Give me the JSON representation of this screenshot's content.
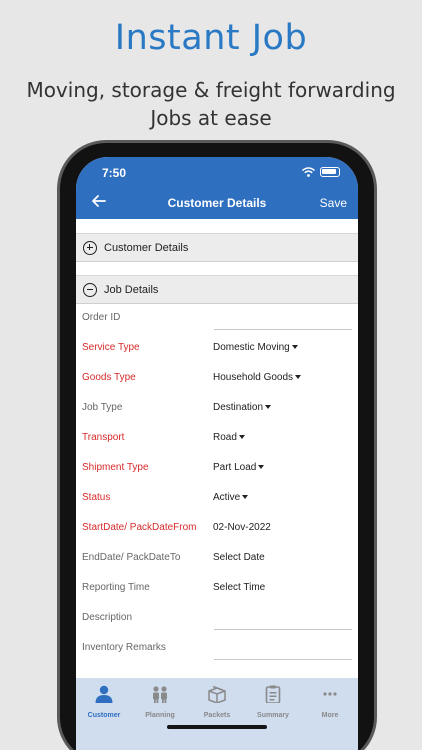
{
  "promo": {
    "title": "Instant Job",
    "subtitle_line1": "Moving, storage & freight forwarding",
    "subtitle_line2": "Jobs at ease"
  },
  "colors": {
    "brand_blue": "#2f6fc0",
    "title_blue": "#2a79c4",
    "required_red": "#d72a2a",
    "tabbar_bg": "#cfddef"
  },
  "status_bar": {
    "time": "7:50",
    "icons": [
      "wifi-icon",
      "battery-icon"
    ]
  },
  "nav": {
    "back_icon": "back-arrow-icon",
    "title": "Customer Details",
    "save_label": "Save"
  },
  "sections": [
    {
      "label": "Customer Details",
      "icon": "plus-circle-icon",
      "state": "collapsed"
    },
    {
      "label": "Job Details",
      "icon": "minus-circle-icon",
      "state": "expanded"
    }
  ],
  "fields": [
    {
      "label": "Order ID",
      "value": "",
      "required": false
    },
    {
      "label": "Service Type",
      "value": "Domestic Moving",
      "required": true
    },
    {
      "label": "Goods Type",
      "value": "Household Goods",
      "required": true
    },
    {
      "label": "Job Type",
      "value": "Destination",
      "required": false
    },
    {
      "label": "Transport",
      "value": "Road",
      "required": true
    },
    {
      "label": "Shipment Type",
      "value": "Part Load",
      "required": true
    },
    {
      "label": "Status",
      "value": "Active",
      "required": true
    },
    {
      "label": "StartDate/ PackDateFrom",
      "value": "02-Nov-2022",
      "required": true
    },
    {
      "label": "EndDate/ PackDateTo",
      "value": "Select Date",
      "required": false
    },
    {
      "label": "Reporting Time",
      "value": "Select Time",
      "required": false
    },
    {
      "label": "Description",
      "value": "",
      "required": false
    },
    {
      "label": "Inventory Remarks",
      "value": "",
      "required": false
    }
  ],
  "tabs": [
    {
      "label": "Customer",
      "icon": "person-icon",
      "active": true
    },
    {
      "label": "Planning",
      "icon": "people-icon",
      "active": false
    },
    {
      "label": "Packets",
      "icon": "box-icon",
      "active": false
    },
    {
      "label": "Summary",
      "icon": "clipboard-icon",
      "active": false
    },
    {
      "label": "More",
      "icon": "more-dots-icon",
      "active": false
    }
  ]
}
